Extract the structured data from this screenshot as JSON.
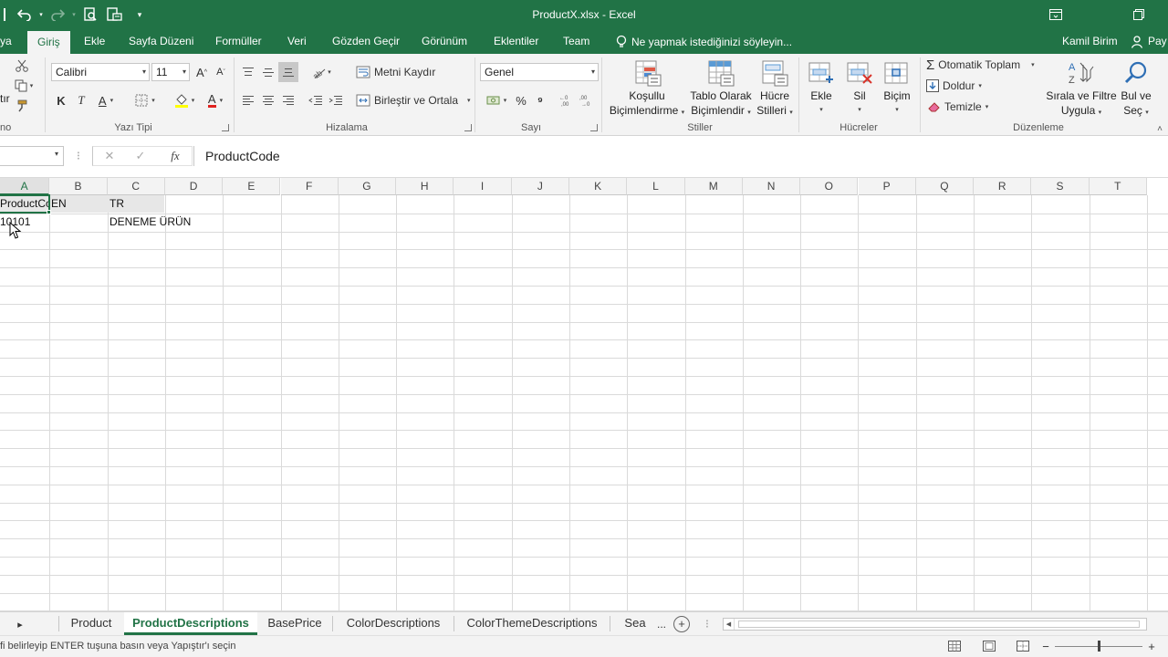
{
  "window": {
    "title": "ProductX.xlsx - Excel",
    "qat_customize": "▾"
  },
  "ribbon_tabs": {
    "file_partial": "ya",
    "home": "Giriş",
    "insert": "Ekle",
    "page_layout": "Sayfa Düzeni",
    "formulas": "Formüller",
    "data": "Veri",
    "review": "Gözden Geçir",
    "view": "Görünüm",
    "addins": "Eklentiler",
    "team": "Team",
    "tell_me": "Ne yapmak istediğinizi söyleyin...",
    "user": "Kamil Birim",
    "share": "Pay"
  },
  "clipboard": {
    "cut_partial": "tır",
    "label_partial": "no"
  },
  "font": {
    "name": "Calibri",
    "size": "11",
    "grow": "A",
    "shrink": "A",
    "bold": "K",
    "italic": "T",
    "underline": "A",
    "font_color": "A",
    "label": "Yazı Tipi"
  },
  "alignment": {
    "wrap_text": "Metni Kaydır",
    "merge_center": "Birleştir ve Ortala",
    "label": "Hizalama"
  },
  "number": {
    "format": "Genel",
    "percent": "%",
    "comma": "⁹",
    "label": "Sayı"
  },
  "styles": {
    "conditional_1": "Koşullu",
    "conditional_2": "Biçimlendirme",
    "table_1": "Tablo Olarak",
    "table_2": "Biçimlendir",
    "cell_1": "Hücre",
    "cell_2": "Stilleri",
    "label": "Stiller"
  },
  "cells": {
    "insert": "Ekle",
    "delete": "Sil",
    "format": "Biçim",
    "label": "Hücreler"
  },
  "editing": {
    "autosum": "Otomatik Toplam",
    "fill": "Doldur",
    "clear": "Temizle",
    "sort_1": "Sırala ve Filtre",
    "sort_2": "Uygula",
    "find_1": "Bul ve",
    "find_2": "Seç",
    "label": "Düzenleme"
  },
  "formula_bar": {
    "cancel": "✕",
    "enter": "✓",
    "fx": "fx",
    "content": "ProductCode"
  },
  "columns": [
    "A",
    "B",
    "C",
    "D",
    "E",
    "F",
    "G",
    "H",
    "I",
    "J",
    "K",
    "L",
    "M",
    "N",
    "O",
    "P",
    "Q",
    "R",
    "S",
    "T"
  ],
  "sheet": {
    "r1": {
      "a": "ProductCode",
      "b": "EN",
      "c": "TR"
    },
    "r2": {
      "a": "10101",
      "c": "DENEME ÜRÜN"
    }
  },
  "sheet_tabs": {
    "nav": "▸",
    "tabs": [
      "Product",
      "ProductDescriptions",
      "BasePrice",
      "ColorDescriptions",
      "ColorThemeDescriptions",
      "Sea"
    ],
    "ellipsis": "...",
    "add": "+"
  },
  "status": {
    "message": "fi belirleyip ENTER tuşuna basın veya Yapıştır'ı seçin",
    "zoom_minus": "−",
    "zoom_plus": "+"
  },
  "colors": {
    "accent": "#217346",
    "ribbon_bg": "#f3f3f3",
    "header_fill": "#e7e7e7"
  }
}
